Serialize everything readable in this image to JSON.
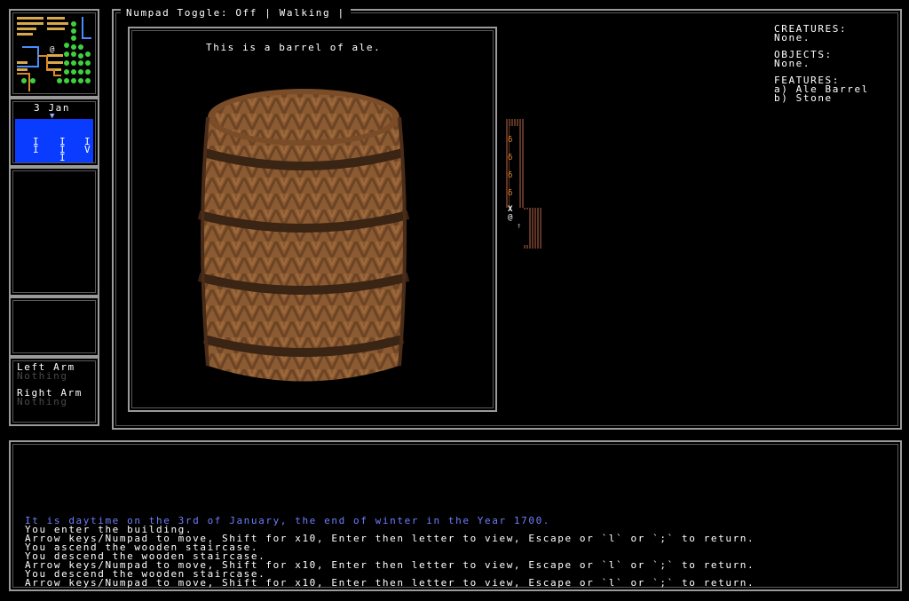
{
  "status_bar": {
    "text": "Numpad Toggle: Off | Walking |"
  },
  "calendar": {
    "date": "3 Jan",
    "marker": "▼",
    "months": [
      [
        "I",
        "I"
      ],
      [
        "I",
        "I",
        "I"
      ],
      [
        "I",
        "V"
      ]
    ]
  },
  "arms": {
    "left_label": "Left Arm",
    "left_value": "Nothing",
    "right_label": "Right Arm",
    "right_value": "Nothing"
  },
  "view": {
    "description": "This is a barrel of ale."
  },
  "info": {
    "creatures_label": "CREATURES:",
    "creatures_value": "None.",
    "objects_label": "OBJECTS:",
    "objects_value": "None.",
    "features_label": "FEATURES:",
    "features": [
      "a) Ale Barrel",
      "b) Stone"
    ]
  },
  "map": {
    "player": "@",
    "cursor": "X",
    "barrel": "δ",
    "stairs": "↑"
  },
  "log": [
    {
      "text": "It is daytime on the 3rd of January, the end of winter in the Year 1700.",
      "color": "#6f7fff"
    },
    {
      "text": "You enter the building.",
      "color": "#ffffff"
    },
    {
      "text": "Arrow keys/Numpad to move, Shift for x10, Enter then letter to view, Escape or `l` or `;` to return.",
      "color": "#ffffff"
    },
    {
      "text": "You ascend the wooden staircase.",
      "color": "#ffffff"
    },
    {
      "text": "You descend the wooden staircase.",
      "color": "#ffffff"
    },
    {
      "text": "Arrow keys/Numpad to move, Shift for x10, Enter then letter to view, Escape or `l` or `;` to return.",
      "color": "#ffffff"
    },
    {
      "text": "You descend the wooden staircase.",
      "color": "#ffffff"
    },
    {
      "text": "Arrow keys/Numpad to move, Shift for x10, Enter then letter to view, Escape or `l` or `;` to return.",
      "color": "#ffffff"
    }
  ],
  "colors": {
    "frame": "#9a9a9a",
    "calendar_bg": "#0a3cff",
    "log_highlight": "#6f7fff",
    "barrel_wood": "#8a5a32",
    "barrel_hoop": "#3a2414"
  }
}
